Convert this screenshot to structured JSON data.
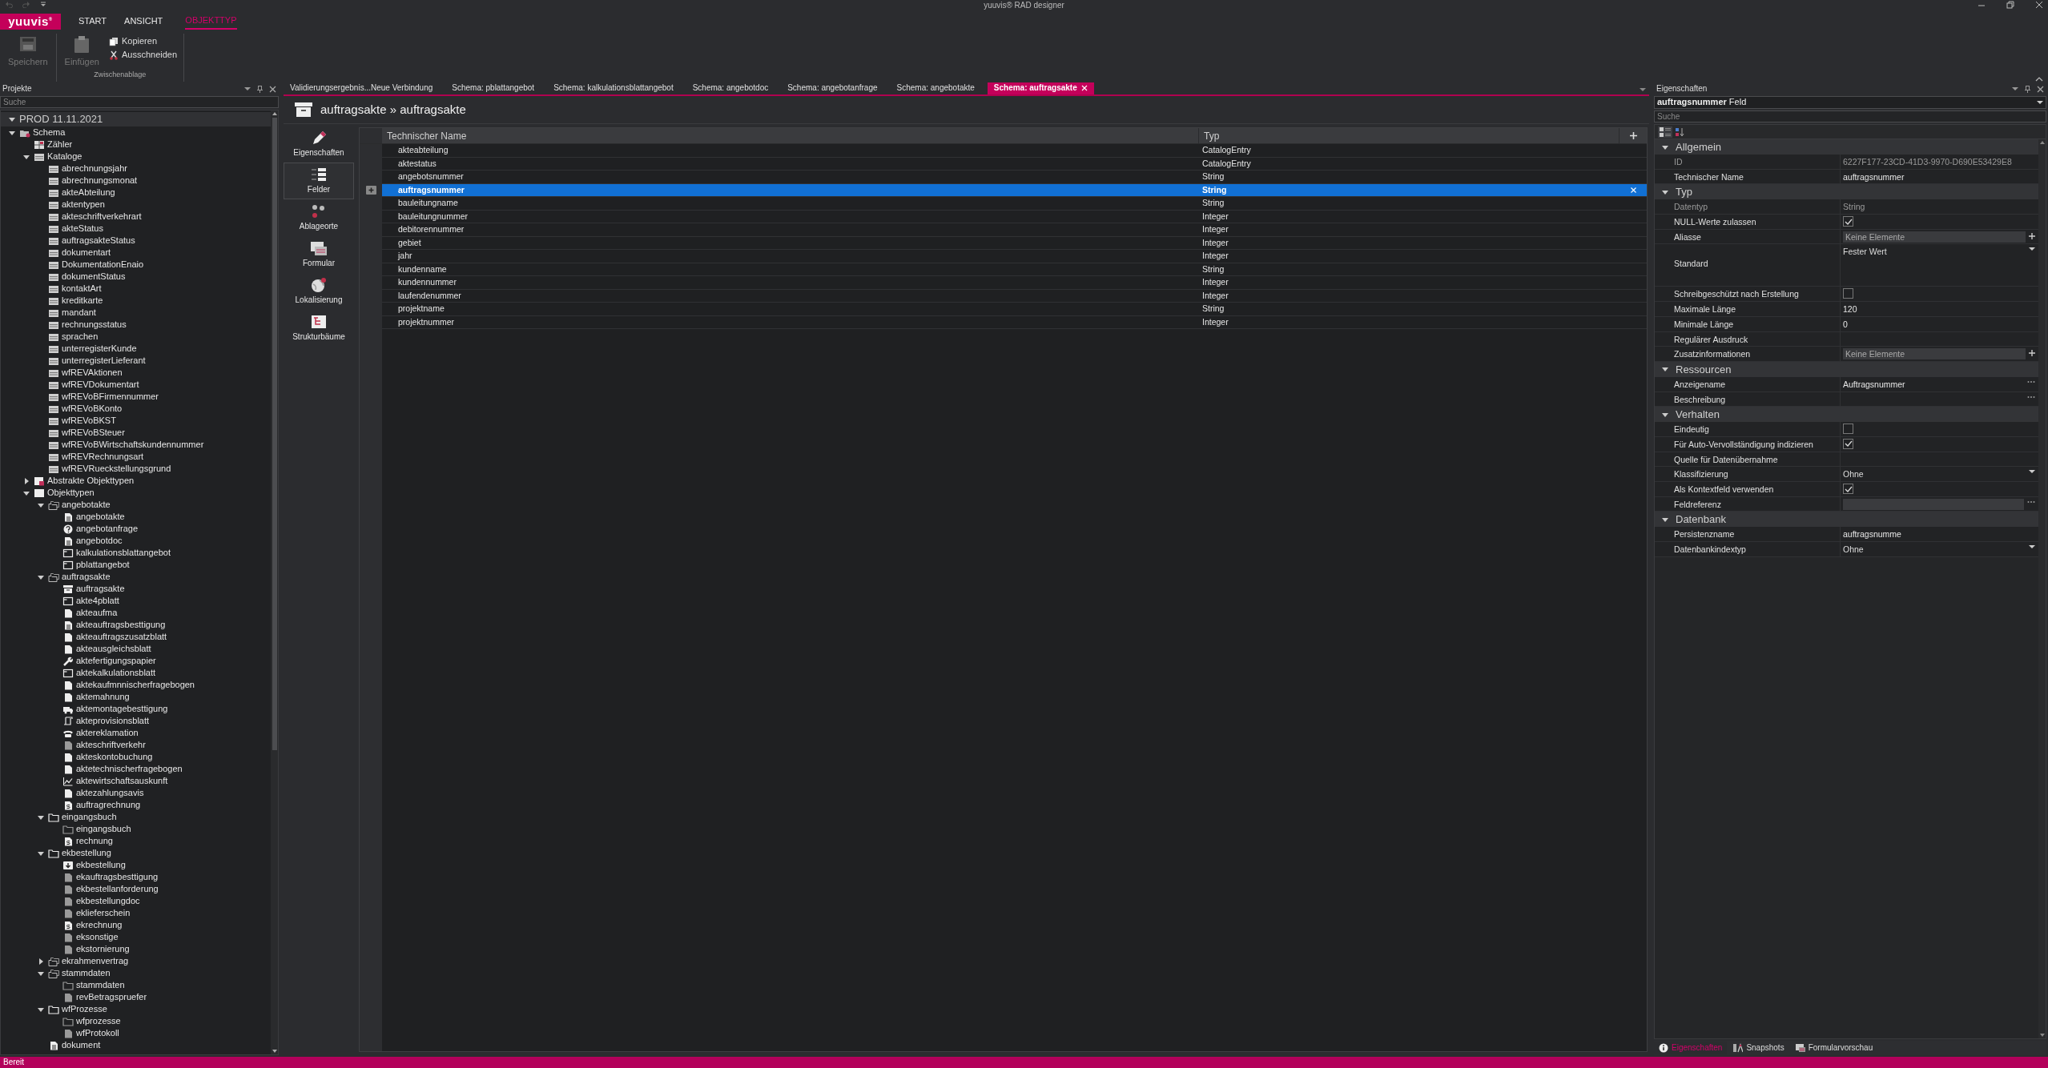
{
  "title_bar": {
    "title": "yuuvis® RAD designer"
  },
  "ribbon": {
    "logo": "yuuvis$^{®}$",
    "tabs": [
      {
        "label": "START",
        "selected": false
      },
      {
        "label": "ANSICHT",
        "selected": false
      },
      {
        "label": "OBJEKTTYP",
        "selected": true
      }
    ],
    "groups": [
      {
        "buttons": [
          {
            "label": "Speichern",
            "kind": "save",
            "disabled": true
          }
        ]
      },
      {
        "label": "Zwischenablage",
        "buttons": [
          {
            "label": "Einfügen",
            "kind": "paste",
            "disabled": true
          },
          {
            "label": "Kopieren",
            "kind": "copy",
            "disabled": false
          },
          {
            "label": "Ausschneiden",
            "kind": "cut",
            "disabled": false
          }
        ]
      }
    ]
  },
  "projects": {
    "title": "Projekte",
    "search": {
      "placeholder": "Suche"
    },
    "root": {
      "label": "PROD 11.11.2021",
      "expanded": true,
      "children": [
        {
          "label": "Schema",
          "kind": "schema",
          "expanded": true,
          "children": [
            {
              "label": "Zähler",
              "kind": "counter"
            },
            {
              "label": "Kataloge",
              "kind": "catalog",
              "expanded": true,
              "children": [
                {
                  "label": "abrechnungsjahr",
                  "kind": "catalog"
                },
                {
                  "label": "abrechnungsmonat",
                  "kind": "catalog"
                },
                {
                  "label": "akteAbteilung",
                  "kind": "catalog"
                },
                {
                  "label": "aktentypen",
                  "kind": "catalog"
                },
                {
                  "label": "akteschriftverkehrart",
                  "kind": "catalog"
                },
                {
                  "label": "akteStatus",
                  "kind": "catalog"
                },
                {
                  "label": "auftragsakteStatus",
                  "kind": "catalog"
                },
                {
                  "label": "dokumentart",
                  "kind": "catalog"
                },
                {
                  "label": "DokumentationEnaio",
                  "kind": "catalog"
                },
                {
                  "label": "dokumentStatus",
                  "kind": "catalog"
                },
                {
                  "label": "kontaktArt",
                  "kind": "catalog"
                },
                {
                  "label": "kreditkarte",
                  "kind": "catalog"
                },
                {
                  "label": "mandant",
                  "kind": "catalog"
                },
                {
                  "label": "rechnungsstatus",
                  "kind": "catalog"
                },
                {
                  "label": "sprachen",
                  "kind": "catalog"
                },
                {
                  "label": "unterregisterKunde",
                  "kind": "catalog"
                },
                {
                  "label": "unterregisterLieferant",
                  "kind": "catalog"
                },
                {
                  "label": "wfREVAktionen",
                  "kind": "catalog"
                },
                {
                  "label": "wfREVDokumentart",
                  "kind": "catalog"
                },
                {
                  "label": "wfREVoBFirmennummer",
                  "kind": "catalog"
                },
                {
                  "label": "wfREVoBKonto",
                  "kind": "catalog"
                },
                {
                  "label": "wfREVoBKST",
                  "kind": "catalog"
                },
                {
                  "label": "wfREVoBSteuer",
                  "kind": "catalog"
                },
                {
                  "label": "wfREVoBWirtschaftskundennummer",
                  "kind": "catalog"
                },
                {
                  "label": "wfREVRechnungsart",
                  "kind": "catalog"
                },
                {
                  "label": "wfREVRueckstellungsgrund",
                  "kind": "catalog"
                }
              ]
            },
            {
              "label": "Abstrakte Objekttypen",
              "kind": "abstract",
              "expanded": false
            },
            {
              "label": "Objekttypen",
              "kind": "objtypes",
              "expanded": true,
              "children": [
                {
                  "label": "angebotakte",
                  "kind": "folders",
                  "expanded": true,
                  "children": [
                    {
                      "label": "angebotakte",
                      "kind": "doclines"
                    },
                    {
                      "label": "angebotanfrage",
                      "kind": "question"
                    },
                    {
                      "label": "angebotdoc",
                      "kind": "doclines"
                    },
                    {
                      "label": "kalkulationsblattangebot",
                      "kind": "form"
                    },
                    {
                      "label": "pblattangebot",
                      "kind": "form"
                    }
                  ]
                },
                {
                  "label": "auftragsakte",
                  "kind": "folders",
                  "expanded": true,
                  "children": [
                    {
                      "label": "auftragsakte",
                      "kind": "archive"
                    },
                    {
                      "label": "akte4pblatt",
                      "kind": "form"
                    },
                    {
                      "label": "akteaufma",
                      "kind": "doc"
                    },
                    {
                      "label": "akteauftragsbesttigung",
                      "kind": "doclines"
                    },
                    {
                      "label": "akteauftragszusatzblatt",
                      "kind": "doc"
                    },
                    {
                      "label": "akteausgleichsblatt",
                      "kind": "doc"
                    },
                    {
                      "label": "aktefertigungspapier",
                      "kind": "wrench"
                    },
                    {
                      "label": "aktekalkulationsblatt",
                      "kind": "form"
                    },
                    {
                      "label": "aktekaufmnnischerfragebogen",
                      "kind": "doc"
                    },
                    {
                      "label": "aktemahnung",
                      "kind": "doc"
                    },
                    {
                      "label": "aktemontagebesttigung",
                      "kind": "truck"
                    },
                    {
                      "label": "akteprovisionsblatt",
                      "kind": "scroll"
                    },
                    {
                      "label": "aktereklamation",
                      "kind": "phone"
                    },
                    {
                      "label": "akteschriftverkehr",
                      "kind": "docgrey"
                    },
                    {
                      "label": "akteskontobuchung",
                      "kind": "doc"
                    },
                    {
                      "label": "aktetechnischerfragebogen",
                      "kind": "doc"
                    },
                    {
                      "label": "aktewirtschaftsauskunft",
                      "kind": "chart"
                    },
                    {
                      "label": "aktezahlungsavis",
                      "kind": "doc"
                    },
                    {
                      "label": "auftragrechnung",
                      "kind": "invoice"
                    }
                  ]
                },
                {
                  "label": "eingangsbuch",
                  "kind": "folder",
                  "expanded": true,
                  "children": [
                    {
                      "label": "eingangsbuch",
                      "kind": "folderdim"
                    },
                    {
                      "label": "rechnung",
                      "kind": "invoice"
                    }
                  ]
                },
                {
                  "label": "ekbestellung",
                  "kind": "folder",
                  "expanded": true,
                  "children": [
                    {
                      "label": "ekbestellung",
                      "kind": "download"
                    },
                    {
                      "label": "ekauftragsbesttigung",
                      "kind": "docgrey"
                    },
                    {
                      "label": "ekbestellanforderung",
                      "kind": "docgrey"
                    },
                    {
                      "label": "ekbestellungdoc",
                      "kind": "docgrey"
                    },
                    {
                      "label": "eklieferschein",
                      "kind": "docgrey"
                    },
                    {
                      "label": "ekrechnung",
                      "kind": "invoice"
                    },
                    {
                      "label": "eksonstige",
                      "kind": "docgrey"
                    },
                    {
                      "label": "ekstornierung",
                      "kind": "docgrey"
                    }
                  ]
                },
                {
                  "label": "ekrahmenvertrag",
                  "kind": "folders",
                  "expanded": false
                },
                {
                  "label": "stammdaten",
                  "kind": "folders",
                  "expanded": true,
                  "children": [
                    {
                      "label": "stammdaten",
                      "kind": "folderdim"
                    },
                    {
                      "label": "revBetragspruefer",
                      "kind": "docgrey"
                    }
                  ]
                },
                {
                  "label": "wfProzesse",
                  "kind": "folder",
                  "expanded": true,
                  "children": [
                    {
                      "label": "wfprozesse",
                      "kind": "folderdim"
                    },
                    {
                      "label": "wfProtokoll",
                      "kind": "docgrey"
                    }
                  ]
                },
                {
                  "label": "dokument",
                  "kind": "doclines"
                }
              ]
            }
          ]
        }
      ]
    }
  },
  "editor": {
    "tabs": [
      {
        "label": "Validierungsergebnis...Neue Verbindung",
        "selected": false
      },
      {
        "label": "Schema: pblattangebot",
        "selected": false
      },
      {
        "label": "Schema: kalkulationsblattangebot",
        "selected": false
      },
      {
        "label": "Schema: angebotdoc",
        "selected": false
      },
      {
        "label": "Schema: angebotanfrage",
        "selected": false
      },
      {
        "label": "Schema: angebotakte",
        "selected": false
      },
      {
        "label": "Schema: auftragsakte",
        "selected": true
      }
    ],
    "heading": "auftragsakte » auftragsakte",
    "side_nav": [
      {
        "label": "Eigenschaften",
        "selected": false
      },
      {
        "label": "Felder",
        "selected": true
      },
      {
        "label": "Ablageorte",
        "selected": false
      },
      {
        "label": "Formular",
        "selected": false
      },
      {
        "label": "Lokalisierung",
        "selected": false
      },
      {
        "label": "Strukturbäume",
        "selected": false
      }
    ],
    "grid": {
      "columns": [
        "Technischer Name",
        "Typ"
      ],
      "rows": [
        {
          "name": "akteabteilung",
          "type": "CatalogEntry",
          "selected": false
        },
        {
          "name": "aktestatus",
          "type": "CatalogEntry",
          "selected": false
        },
        {
          "name": "angebotsnummer",
          "type": "String",
          "selected": false
        },
        {
          "name": "auftragsnummer",
          "type": "String",
          "selected": true
        },
        {
          "name": "bauleitungname",
          "type": "String",
          "selected": false
        },
        {
          "name": "bauleitungnummer",
          "type": "Integer",
          "selected": false
        },
        {
          "name": "debitorennummer",
          "type": "Integer",
          "selected": false
        },
        {
          "name": "gebiet",
          "type": "Integer",
          "selected": false
        },
        {
          "name": "jahr",
          "type": "Integer",
          "selected": false
        },
        {
          "name": "kundenname",
          "type": "String",
          "selected": false
        },
        {
          "name": "kundennummer",
          "type": "Integer",
          "selected": false
        },
        {
          "name": "laufendenummer",
          "type": "Integer",
          "selected": false
        },
        {
          "name": "projektname",
          "type": "String",
          "selected": false
        },
        {
          "name": "projektnummer",
          "type": "Integer",
          "selected": false
        }
      ]
    }
  },
  "properties": {
    "title": "Eigenschaften",
    "object": "**auftragsnummer** Feld",
    "search": {
      "placeholder": "Suche"
    },
    "categories": [
      {
        "label": "Allgemein",
        "expanded": true,
        "rows": [
          {
            "label": "ID",
            "kind": "text",
            "value": "6227F177-23CD-41D3-9970-D690E53429E8",
            "disabled": true
          },
          {
            "label": "Technischer Name",
            "kind": "text",
            "value": "auftragsnummer",
            "disabled": false
          }
        ]
      },
      {
        "label": "Typ",
        "expanded": true,
        "rows": [
          {
            "label": "Datentyp",
            "kind": "text",
            "value": "String",
            "disabled": true
          },
          {
            "label": "NULL-Werte zulassen",
            "kind": "check",
            "checked": true,
            "disabled": false
          },
          {
            "label": "Aliasse",
            "kind": "list",
            "value": "Keine Elemente",
            "disabled": false
          },
          {
            "label": "Standard",
            "kind": "tall_dropdown",
            "value": "Fester Wert",
            "disabled": false
          },
          {
            "label": "Schreibgeschützt nach Erstellung",
            "kind": "check",
            "checked": false,
            "disabled": false
          },
          {
            "label": "Maximale Länge",
            "kind": "text",
            "value": "120",
            "disabled": false
          },
          {
            "label": "Minimale Länge",
            "kind": "text",
            "value": "0",
            "disabled": false
          },
          {
            "label": "Regulärer Ausdruck",
            "kind": "text",
            "disabled": false
          },
          {
            "label": "Zusatzinformationen",
            "kind": "list",
            "value": "Keine Elemente",
            "disabled": false
          }
        ]
      },
      {
        "label": "Ressourcen",
        "expanded": true,
        "rows": [
          {
            "label": "Anzeigename",
            "kind": "ellipsis",
            "value": "Auftragsnummer",
            "disabled": false
          },
          {
            "label": "Beschreibung",
            "kind": "ellipsis",
            "disabled": false
          }
        ]
      },
      {
        "label": "Verhalten",
        "expanded": true,
        "rows": [
          {
            "label": "Eindeutig",
            "kind": "check",
            "checked": false,
            "disabled": false
          },
          {
            "label": "Für Auto-Vervollständigung indizieren",
            "kind": "check",
            "checked": true,
            "disabled": false
          },
          {
            "label": "Quelle für Datenübernahme",
            "kind": "text",
            "disabled": false
          },
          {
            "label": "Klassifizierung",
            "kind": "dropdown",
            "value": "Ohne",
            "disabled": false
          },
          {
            "label": "Als Kontextfeld verwenden",
            "kind": "check",
            "checked": true,
            "disabled": false
          },
          {
            "label": "Feldreferenz",
            "kind": "reference",
            "disabled": false
          }
        ]
      },
      {
        "label": "Datenbank",
        "expanded": true,
        "rows": [
          {
            "label": "Persistenzname",
            "kind": "text",
            "value": "auftragsnumme",
            "disabled": false
          },
          {
            "label": "Datenbankindextyp",
            "kind": "dropdown",
            "value": "Ohne",
            "disabled": false
          }
        ]
      }
    ],
    "bottom_tabs": [
      {
        "label": "Eigenschaften",
        "selected": true
      },
      {
        "label": "Snapshots",
        "selected": false
      },
      {
        "label": "Formularvorschau",
        "selected": false
      }
    ]
  },
  "status_bar": {
    "text": "Bereit"
  }
}
